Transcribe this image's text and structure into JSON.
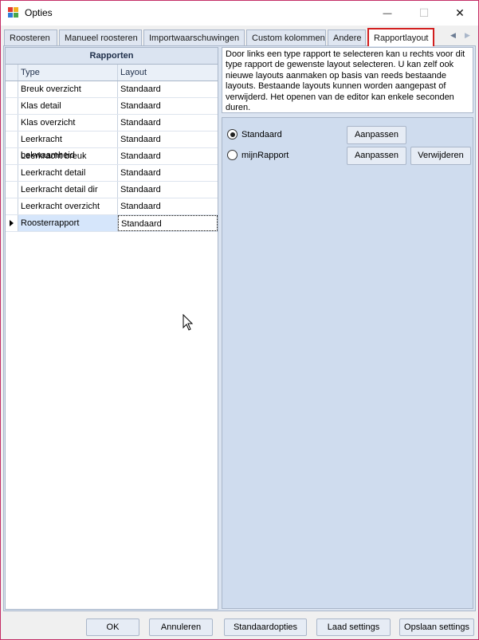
{
  "window": {
    "title": "Opties",
    "controls": {
      "minimize": "—",
      "maximize": "☐",
      "close": "✕"
    }
  },
  "tabs": [
    {
      "label": "Roosteren",
      "active": false
    },
    {
      "label": "Manueel roosteren",
      "active": false
    },
    {
      "label": "Importwaarschuwingen",
      "active": false
    },
    {
      "label": "Custom kolommen",
      "active": false
    },
    {
      "label": "Andere",
      "active": false
    },
    {
      "label": "Rapportlayout",
      "active": true
    }
  ],
  "tab_scroll": {
    "left": "◀",
    "right": "▶"
  },
  "grid": {
    "caption": "Rapporten",
    "columns": {
      "type": "Type",
      "layout": "Layout"
    },
    "rows": [
      {
        "type": "Breuk overzicht",
        "layout": "Standaard"
      },
      {
        "type": "Klas detail",
        "layout": "Standaard"
      },
      {
        "type": "Klas overzicht",
        "layout": "Standaard"
      },
      {
        "type": "Leerkracht bekwaamheid",
        "layout": "Standaard"
      },
      {
        "type": "Leerkracht breuk",
        "layout": "Standaard"
      },
      {
        "type": "Leerkracht detail",
        "layout": "Standaard"
      },
      {
        "type": "Leerkracht detail dir",
        "layout": "Standaard"
      },
      {
        "type": "Leerkracht overzicht",
        "layout": "Standaard"
      },
      {
        "type": "Roosterrapport",
        "layout": "Standaard",
        "selected": true
      }
    ]
  },
  "description": "Door links een type rapport te selecteren kan u rechts voor dit type rapport de gewenste layout selecteren. U kan zelf ook nieuwe layouts aanmaken op basis van reeds bestaande layouts. Bestaande layouts kunnen worden aangepast of verwijderd. Het openen van de editor kan enkele seconden duren.",
  "layouts": [
    {
      "name": "Standaard",
      "checked": true,
      "edit_label": "Aanpassen"
    },
    {
      "name": "mijnRapport",
      "checked": false,
      "edit_label": "Aanpassen",
      "delete_label": "Verwijderen"
    }
  ],
  "footer": {
    "ok": "OK",
    "cancel": "Annuleren",
    "defaults": "Standaardopties",
    "load": "Laad settings",
    "save": "Opslaan settings"
  },
  "colors": {
    "active_tab_border": "#d21f1f",
    "window_border": "#c42e66",
    "panel_bg": "#cfdcee"
  }
}
